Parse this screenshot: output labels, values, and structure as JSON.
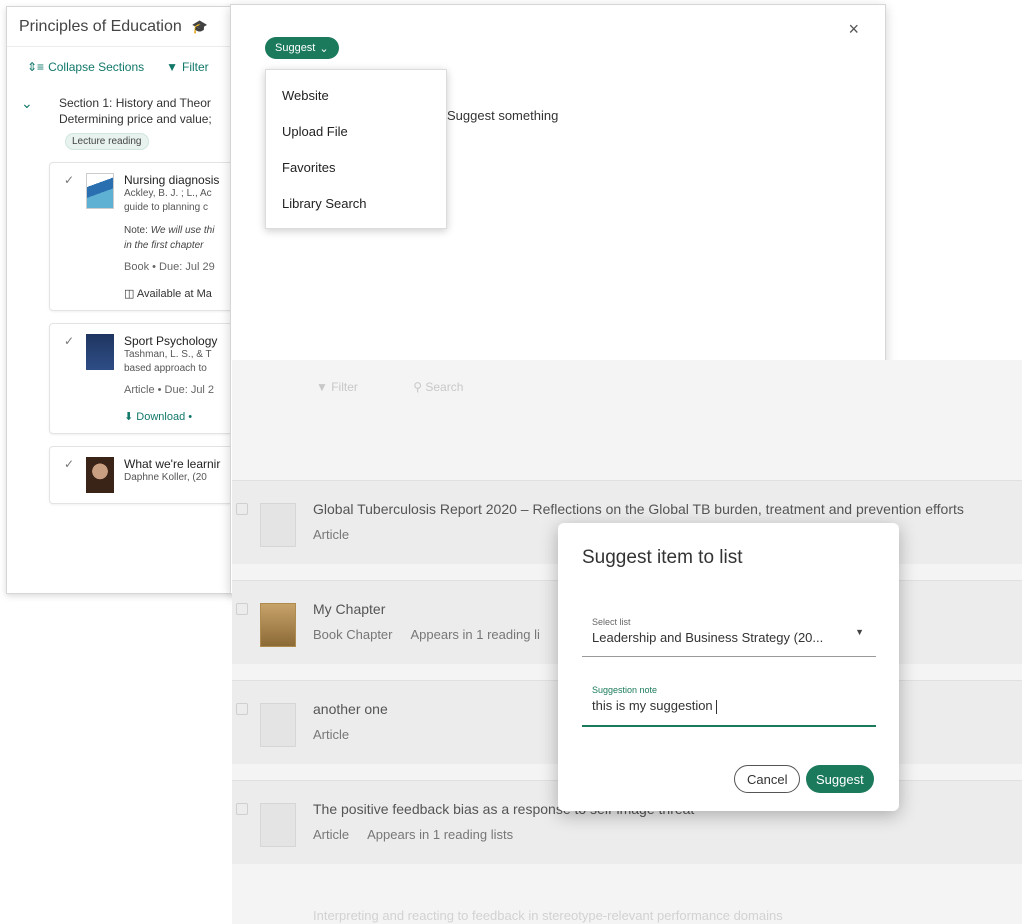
{
  "left_panel": {
    "title": "Principles of Education",
    "toolbar": {
      "collapse": "Collapse Sections",
      "filter": "Filter"
    },
    "section": {
      "title": "Section 1: History and Theor",
      "subtitle": "Determining price and value; ",
      "badge": "Lecture reading"
    },
    "cards": [
      {
        "title": "Nursing diagnosis",
        "authors": "Ackley, B. J. ; L., Ac",
        "desc": "guide to planning c",
        "note_label": "Note: ",
        "note_line1": "We will use thi",
        "note_line2": "in the first chapter",
        "meta": "Book • Due: Jul 29",
        "action": "Available at Ma"
      },
      {
        "title": "Sport Psychology",
        "authors": "Tashman, L. S., & T",
        "desc": "based approach to",
        "meta": "Article • Due: Jul 2",
        "action": "Download • "
      },
      {
        "title": "What we're learnir",
        "authors": "Daphne Koller, (20"
      }
    ]
  },
  "top_modal": {
    "suggest_label": "Suggest",
    "menu_items": [
      "Website",
      "Upload File",
      "Favorites",
      "Library Search"
    ],
    "suggest_something": "Suggest something",
    "close_symbol": "×"
  },
  "list_panel": {
    "toolbar_filter": "Filter",
    "toolbar_search": "Search",
    "rows": [
      {
        "title": "Global Tuberculosis Report 2020 – Reflections on the Global TB burden, treatment and prevention efforts",
        "type": "Article",
        "appears": ""
      },
      {
        "title": "My Chapter",
        "type": "Book Chapter",
        "appears": "Appears in 1 reading li"
      },
      {
        "title": "another one",
        "type": "Article",
        "appears": ""
      },
      {
        "title": "The positive feedback bias as a response to self-image threat",
        "type": "Article",
        "appears": "Appears in 1 reading lists"
      }
    ],
    "faded_row": "Interpreting and reacting to feedback in stereotype-relevant performance domains"
  },
  "dialog": {
    "title": "Suggest item to list",
    "select_label": "Select list",
    "select_value": "Leadership and Business Strategy (20...",
    "note_label": "Suggestion note",
    "note_value": "this is my suggestion",
    "cancel": "Cancel",
    "suggest": "Suggest"
  },
  "colors": {
    "accent": "#1b7a5c",
    "link": "#11786a",
    "cap_icon": "#6b1f8c"
  },
  "icons": [
    "graduation-cap-icon",
    "collapse-icon",
    "filter-icon",
    "chevron-down-icon",
    "check-circle-icon",
    "book-open-icon",
    "download-icon",
    "close-icon",
    "search-icon",
    "dropdown-caret-icon"
  ]
}
